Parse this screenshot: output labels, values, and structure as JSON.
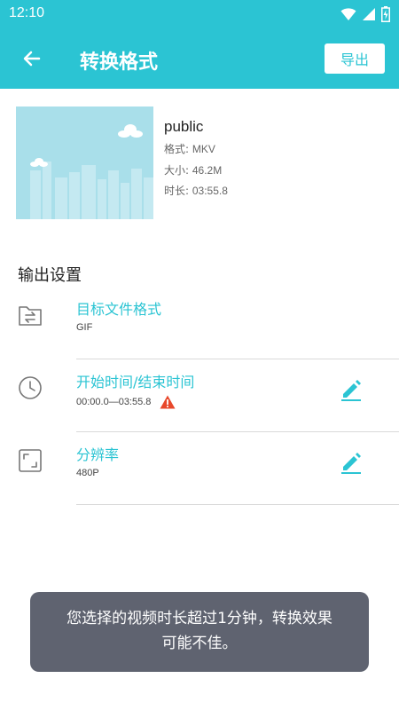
{
  "status_bar": {
    "time": "12:10",
    "icons": [
      "wifi-icon",
      "signal-icon",
      "battery-icon"
    ]
  },
  "app_bar": {
    "title": "转换格式",
    "export_label": "导出",
    "back_icon": "arrow-back-icon"
  },
  "file": {
    "name": "public",
    "format_label": "格式: ",
    "format_value": "MKV",
    "size_label": "大小: ",
    "size_value": "46.2M",
    "duration_label": "时长: ",
    "duration_value": "03:55.8"
  },
  "output_settings": {
    "title": "输出设置",
    "items": [
      {
        "label": "目标文件格式",
        "value": "GIF",
        "icon": "folder-convert-icon",
        "editable": false
      },
      {
        "label": "开始时间/结束时间",
        "value": "00:00.0—03:55.8",
        "icon": "clock-icon",
        "editable": true,
        "warning": true
      },
      {
        "label": "分辨率",
        "value": "480P",
        "icon": "resize-icon",
        "editable": true
      }
    ]
  },
  "toast": {
    "message": "您选择的视频时长超过1分钟，转换效果可能不佳。"
  },
  "colors": {
    "accent": "#2bc4d3",
    "toast_bg": "#5f6370",
    "warning": "#e8482b"
  }
}
